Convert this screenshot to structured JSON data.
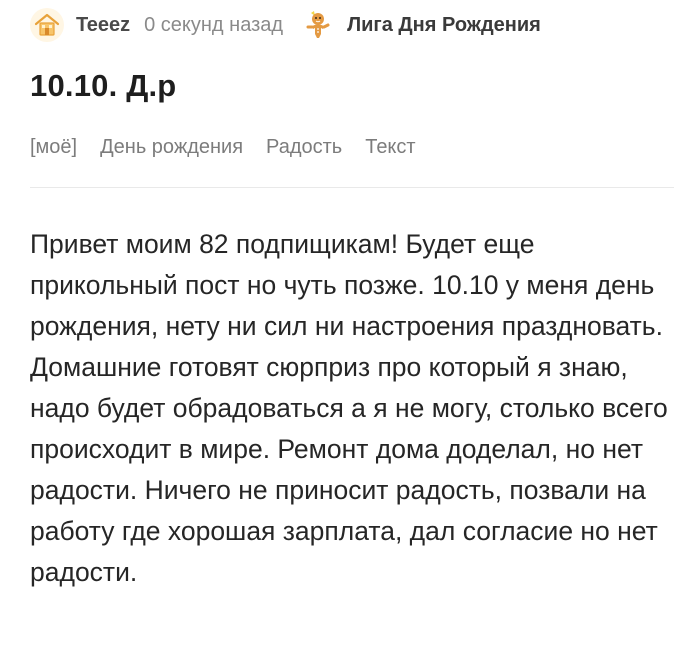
{
  "post": {
    "author": "Teeez",
    "time": "0 секунд назад",
    "community": "Лига Дня Рождения",
    "title": "10.10. Д.р",
    "tags": [
      "[моё]",
      "День рождения",
      "Радость",
      "Текст"
    ],
    "body": "Привет моим 82 подпищикам! Будет еще прикольный пост но чуть позже. 10.10 у меня день рождения, нету ни сил ни настроения праздновать. Домашние готовят сюрприз про который я знаю, надо будет обрадоваться а я не могу, столько всего происходит в мире. Ремонт дома доделал, но нет радости. Ничего не приносит радость, позвали на работу где хорошая зарплата, дал согласие но нет радости."
  },
  "icons": {
    "author_avatar": "house-avatar-icon",
    "community_avatar": "gingerbread-man-icon"
  },
  "colors": {
    "author": "#4a4a4a",
    "meta": "#8a8a8a",
    "tags": "#7c7c7c",
    "text": "#262626"
  }
}
